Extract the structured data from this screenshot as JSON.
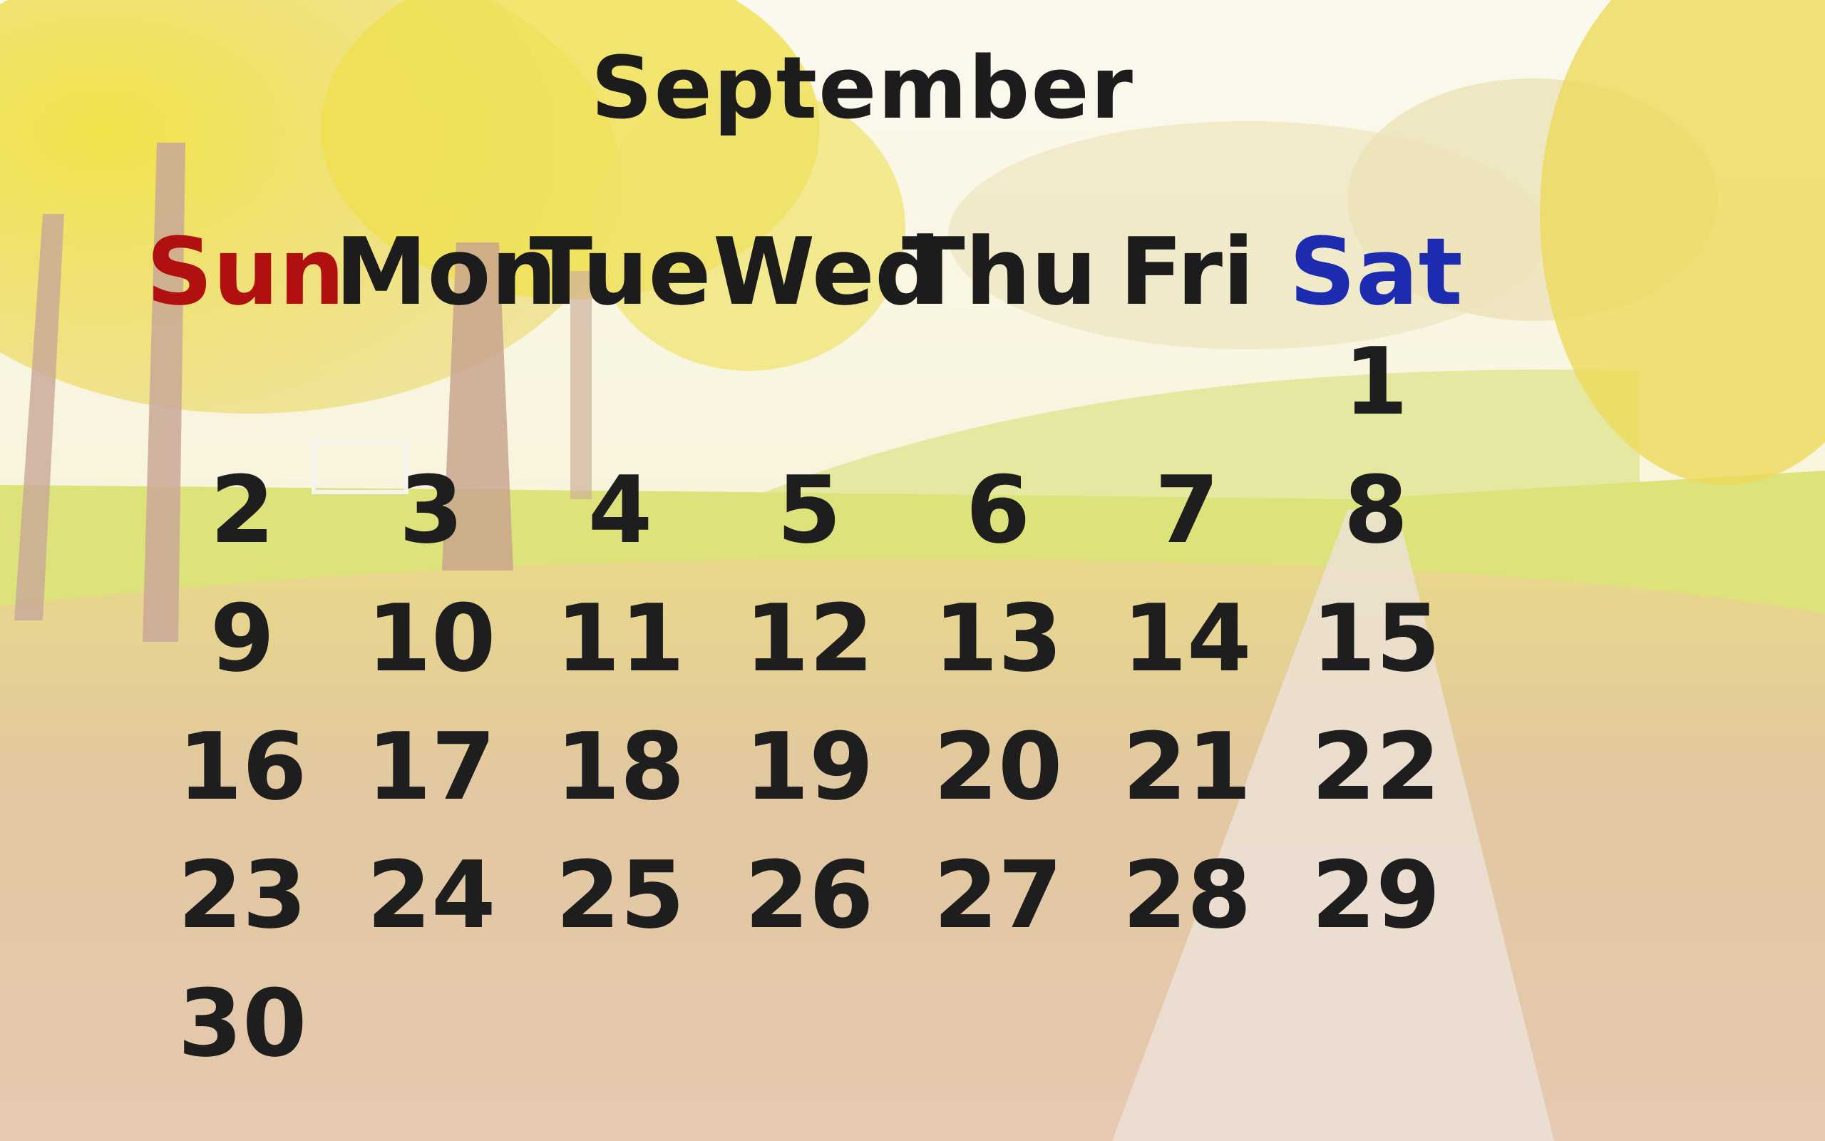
{
  "calendar": {
    "month": "September",
    "weekdays": [
      {
        "label": "Sun",
        "color": "#b01010"
      },
      {
        "label": "Mon",
        "color": "#1c1c1c"
      },
      {
        "label": "Tue",
        "color": "#1c1c1c"
      },
      {
        "label": "Wed",
        "color": "#1c1c1c"
      },
      {
        "label": "Thu",
        "color": "#1c1c1c"
      },
      {
        "label": "Fri",
        "color": "#1c1c1c"
      },
      {
        "label": "Sat",
        "color": "#1c2bb0"
      }
    ],
    "first_weekday_index": 6,
    "days": [
      "1",
      "2",
      "3",
      "4",
      "5",
      "6",
      "7",
      "8",
      "9",
      "10",
      "11",
      "12",
      "13",
      "14",
      "15",
      "16",
      "17",
      "18",
      "19",
      "20",
      "21",
      "22",
      "23",
      "24",
      "25",
      "26",
      "27",
      "28",
      "29",
      "30"
    ]
  },
  "background": {
    "description_colors": {
      "sky": "#fbf7e8",
      "foliage": "#eedd3c",
      "grass": "#d8e06a",
      "leaves": "#d9b38a",
      "path": "#e8ddd6"
    }
  }
}
